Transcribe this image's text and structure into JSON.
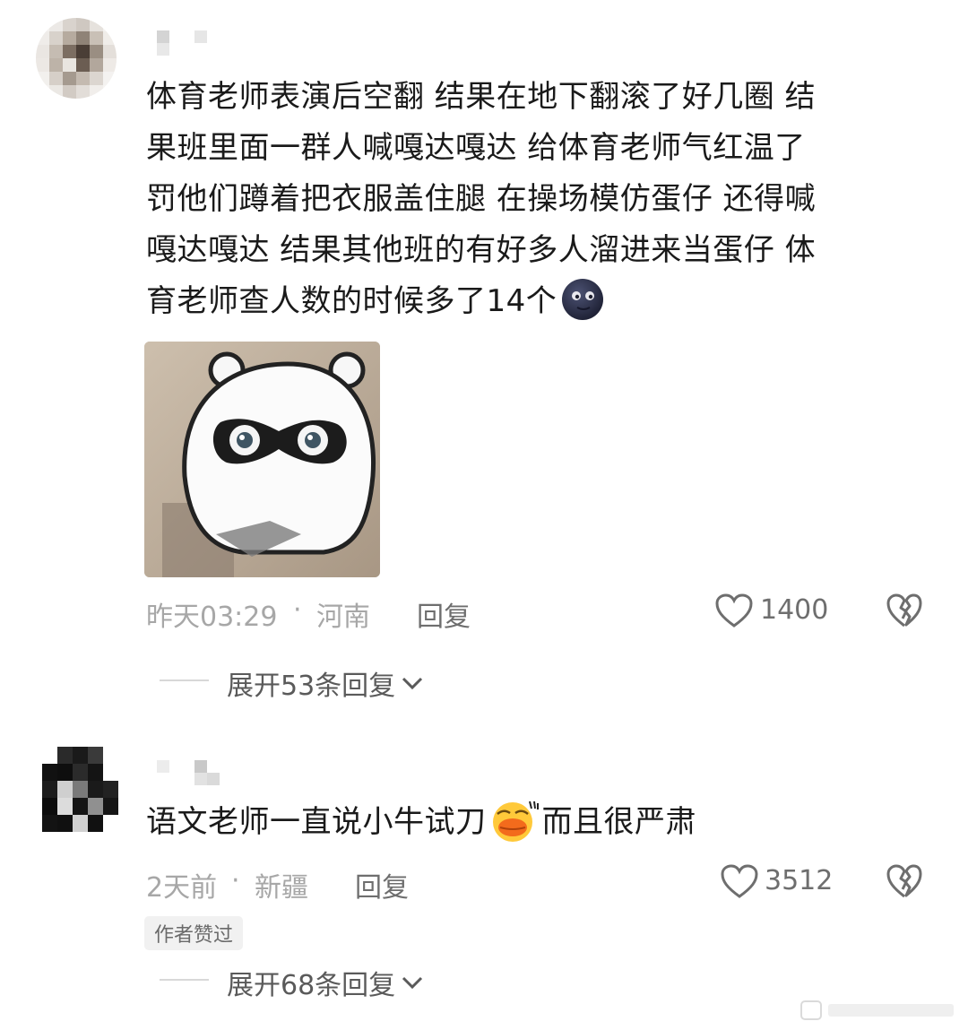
{
  "comments": [
    {
      "text": "体育老师表演后空翻 结果在地下翻滚了好几圈 结果班里面一群人喊嘎达嘎达 给体育老师气红温了 罚他们蹲着把衣服盖住腿 在操场模仿蛋仔 还得喊嘎达嘎达 结果其他班的有好多人溜进来当蛋仔 体育老师查人数的时候多了14个",
      "lines": [
        "体育老师表演后空翻 结果在地下翻滚了好几圈 结",
        "果班里面一群人喊嘎达嘎达 给体育老师气红温了",
        "罚他们蹲着把衣服盖住腿 在操场模仿蛋仔 还得喊",
        "嘎达嘎达 结果其他班的有好多人溜进来当蛋仔 体",
        "育老师查人数的时候多了14个"
      ],
      "emoji": "moon-face-icon",
      "time": "昨天03:29",
      "separator": "·",
      "location": "河南",
      "reply_label": "回复",
      "likes": "1400",
      "expand_label": "展开53条回复"
    },
    {
      "text": "语文老师一直说小牛试刀而且很严肃",
      "line_before": "语文老师一直说小牛试刀",
      "line_after": "而且很严肃",
      "emoji": "duck-face-icon",
      "time": "2天前",
      "separator": "·",
      "location": "新疆",
      "reply_label": "回复",
      "likes": "3512",
      "badge": "作者赞过",
      "expand_label": "展开68条回复"
    }
  ],
  "colors": {
    "text": "#1a1a1a",
    "meta": "#a7a7a7",
    "secondary": "#6e6e6e",
    "badge_bg": "#f1f1f1"
  }
}
